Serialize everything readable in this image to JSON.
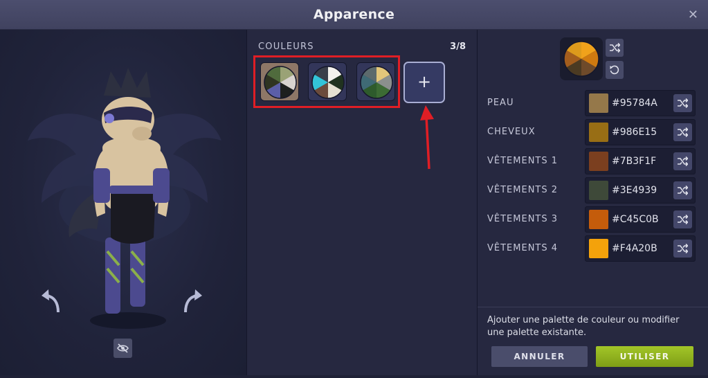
{
  "window": {
    "title": "Apparence",
    "close_icon": "close-icon"
  },
  "palettes": {
    "label": "COULEURS",
    "count": "3/8",
    "items": [
      {
        "colors": [
          "#9aa276",
          "#d8d3cf",
          "#1d1f1e",
          "#5b5ea8",
          "#2f3422",
          "#506b3d"
        ],
        "selected": true
      },
      {
        "colors": [
          "#f4f2ee",
          "#20321f",
          "#e6e1d2",
          "#6b4b3c",
          "#33c4d8",
          "#3a3f4a"
        ],
        "selected": false
      },
      {
        "colors": [
          "#e3c67a",
          "#8b8f8d",
          "#3c6b34",
          "#2e5b2c",
          "#3f6a75",
          "#5c6a6c"
        ],
        "selected": false
      }
    ],
    "add_label": "+"
  },
  "preview": {
    "colors": [
      "#f0a21b",
      "#cf7a10",
      "#6e4a2a",
      "#4b3a22",
      "#a35d1d",
      "#dd9a1c"
    ]
  },
  "colors": [
    {
      "label": "PEAU",
      "hex": "#95784A"
    },
    {
      "label": "CHEVEUX",
      "hex": "#986E15"
    },
    {
      "label": "VÊTEMENTS 1",
      "hex": "#7B3F1F"
    },
    {
      "label": "VÊTEMENTS 2",
      "hex": "#3E4939"
    },
    {
      "label": "VÊTEMENTS 3",
      "hex": "#C45C0B"
    },
    {
      "label": "VÊTEMENTS 4",
      "hex": "#F4A20B"
    }
  ],
  "help_text": "Ajouter une palette de couleur ou modifier une palette existante.",
  "buttons": {
    "cancel": "ANNULER",
    "use": "UTILISER"
  }
}
